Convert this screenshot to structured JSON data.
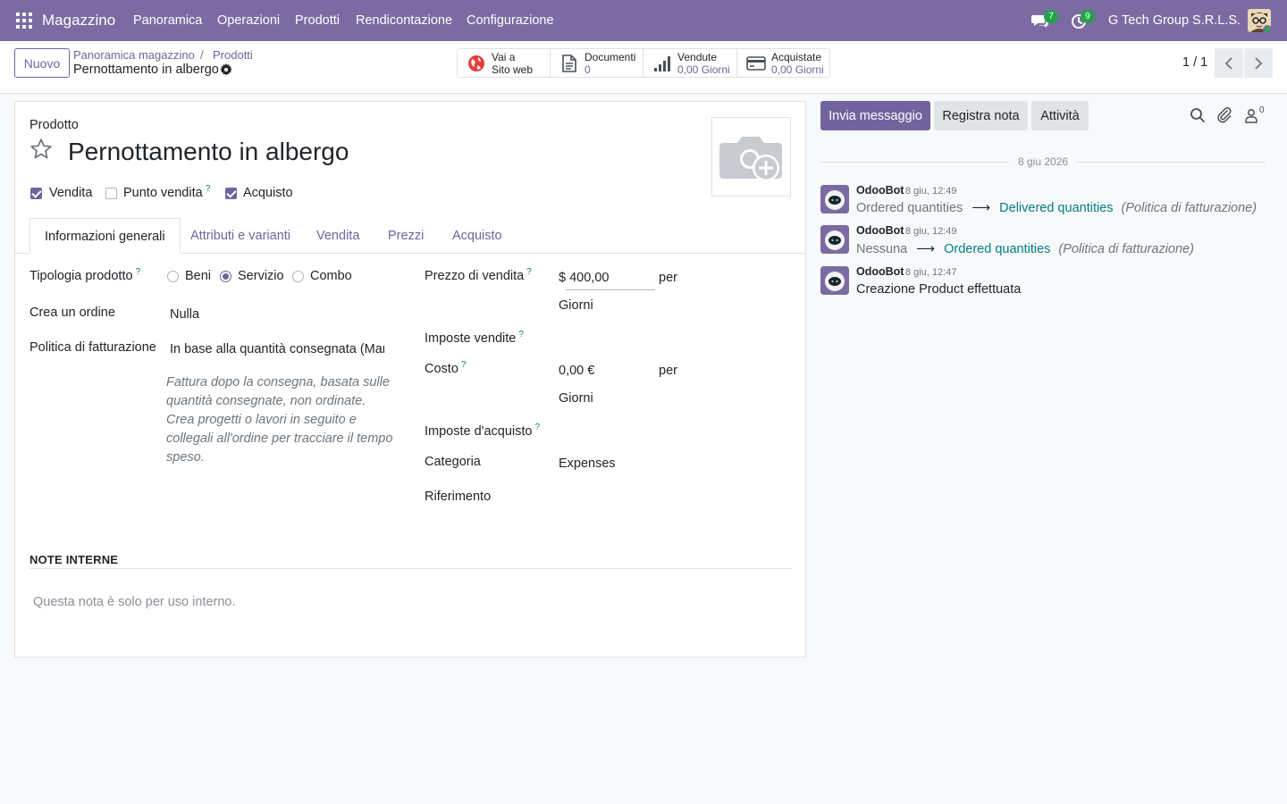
{
  "navbar": {
    "brand": "Magazzino",
    "menu": [
      "Panoramica",
      "Operazioni",
      "Prodotti",
      "Rendicontazione",
      "Configurazione"
    ],
    "messages_count": "7",
    "activities_count": "9",
    "company": "G Tech Group S.R.L.S."
  },
  "control_panel": {
    "new_label": "Nuovo",
    "breadcrumb_1": "Panoramica magazzino",
    "breadcrumb_sep": "/",
    "breadcrumb_2": "Prodotti",
    "record_title": "Pernottamento in albergo",
    "smart_buttons": {
      "website": {
        "line1": "Vai a",
        "line2": "Sito web"
      },
      "documents": {
        "line1": "Documenti",
        "line2": "0"
      },
      "sold": {
        "line1": "Vendute",
        "line2": "0,00 Giorni"
      },
      "purchased": {
        "line1": "Acquistate",
        "line2": "0,00 Giorni"
      }
    },
    "pager": "1 / 1"
  },
  "form": {
    "product_label": "Prodotto",
    "name": "Pernottamento in albergo",
    "flags": {
      "sale": {
        "label": "Vendita",
        "checked": true
      },
      "pos": {
        "label": "Punto vendita",
        "checked": false,
        "help": "?"
      },
      "purchase": {
        "label": "Acquisto",
        "checked": true
      }
    },
    "tabs": [
      "Informazioni generali",
      "Attributi e varianti",
      "Vendita",
      "Prezzi",
      "Acquisto"
    ],
    "active_tab": "Informazioni generali",
    "left": {
      "type_label": "Tipologia prodotto",
      "type_help": "?",
      "type_options": [
        "Beni",
        "Servizio",
        "Combo"
      ],
      "type_selected": "Servizio",
      "create_order_label": "Crea un ordine",
      "create_order_value": "Nulla",
      "invoice_policy_label": "Politica di fatturazione",
      "invoice_policy_value": "In base alla quantità consegnata (Manuale)",
      "invoice_policy_help": "Fattura dopo la consegna, basata sulle quantità consegnate, non ordinate. Crea progetti o lavori in seguito e collegali all'ordine per tracciare il tempo speso."
    },
    "right": {
      "sale_price_label": "Prezzo di vendita",
      "sale_price_help": "?",
      "sale_price_value": "$ 400,00",
      "sale_price_per": "per",
      "sale_price_uom": "Giorni",
      "sale_taxes_label": "Imposte vendite",
      "sale_taxes_help": "?",
      "cost_label": "Costo",
      "cost_help": "?",
      "cost_value": "0,00 €",
      "cost_per": "per",
      "cost_uom": "Giorni",
      "purchase_taxes_label": "Imposte d'acquisto",
      "purchase_taxes_help": "?",
      "category_label": "Categoria",
      "category_value": "Expenses",
      "reference_label": "Riferimento"
    },
    "notes_title": "NOTE INTERNE",
    "notes_placeholder": "Questa nota è solo per uso interno."
  },
  "chatter": {
    "send_message": "Invia messaggio",
    "log_note": "Registra nota",
    "activities": "Attività",
    "followers_count": "0",
    "date_separator": "8 giu 2026",
    "messages": [
      {
        "author": "OdooBot",
        "time": "8 giu, 12:49",
        "old": "Ordered quantities",
        "new": "Delivered quantities",
        "field": "(Politica di fatturazione)"
      },
      {
        "author": "OdooBot",
        "time": "8 giu, 12:49",
        "old": "Nessuna",
        "new": "Ordered quantities",
        "field": "(Politica di fatturazione)"
      },
      {
        "author": "OdooBot",
        "time": "8 giu, 12:47",
        "text": "Creazione Product effettuata"
      }
    ]
  },
  "colors": {
    "navbar": "#7c6ba3",
    "primary": "#71639e",
    "link_teal": "#017e84",
    "badge_green": "#21a349"
  }
}
